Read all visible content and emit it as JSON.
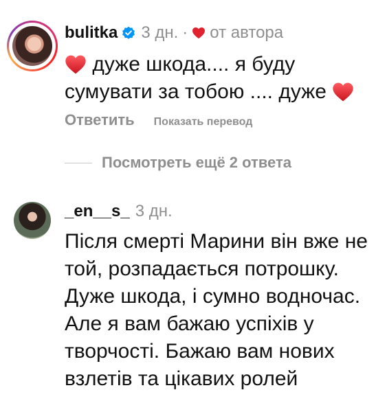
{
  "comments": [
    {
      "username": "bulitka",
      "verified": true,
      "time": "3 дн.",
      "separator": "·",
      "author_liked_label": "от автора",
      "text": "дуже шкода.... я буду сумувати за тобою .... дуже",
      "reply_label": "Ответить",
      "translate_label": "Показать перевод",
      "avatar_icon": "avatar-image"
    },
    {
      "username": "_en__s_",
      "verified": false,
      "time": "3 дн.",
      "text": "Після смерті Марини він вже не той, розпадається потрошку.  Дуже шкода, і сумно водночас. Але я вам бажаю успіхів у творчості. Бажаю вам нових взлетів та цікавих ролей",
      "avatar_icon": "avatar-image"
    }
  ],
  "view_replies_label": "Посмотреть ещё 2 ответа",
  "colors": {
    "heart": "#e0242f",
    "verified_badge": "#0095f6",
    "secondary_text": "#8e8e8e",
    "primary_text": "#111111"
  },
  "icons": {
    "heart": "heart-icon",
    "verified": "verified-badge-icon"
  }
}
